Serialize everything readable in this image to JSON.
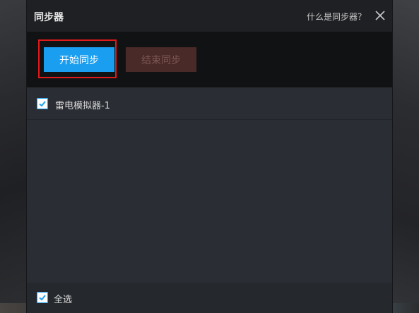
{
  "dialog": {
    "title": "同步器",
    "help_link": "什么是同步器？"
  },
  "toolbar": {
    "start_label": "开始同步",
    "stop_label": "结束同步"
  },
  "list": {
    "items": [
      {
        "label": "雷电模拟器-1",
        "checked": true
      }
    ]
  },
  "footer": {
    "select_all_label": "全选",
    "select_all_checked": true
  },
  "colors": {
    "accent": "#1a9ff0",
    "highlight_border": "#e11a1a",
    "stop_disabled": "#4a2a28"
  }
}
